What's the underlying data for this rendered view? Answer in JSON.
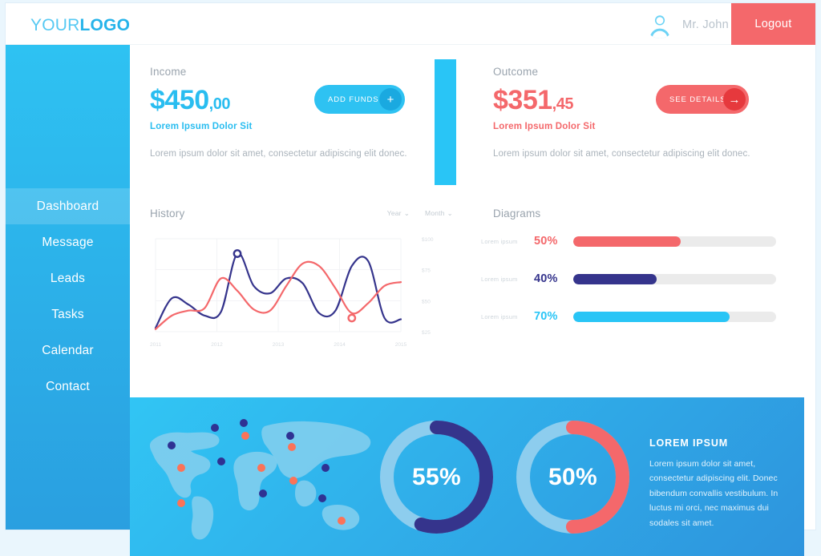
{
  "header": {
    "logo_part1": "YOUR",
    "logo_part2": "LOGO",
    "username": "Mr. John",
    "logout_label": "Logout",
    "avatar_icon": "user-avatar-icon"
  },
  "sidebar": {
    "items": [
      {
        "label": "Dashboard",
        "active": true
      },
      {
        "label": "Message",
        "active": false
      },
      {
        "label": "Leads",
        "active": false
      },
      {
        "label": "Tasks",
        "active": false
      },
      {
        "label": "Calendar",
        "active": false
      },
      {
        "label": "Contact",
        "active": false
      }
    ]
  },
  "cards": {
    "income": {
      "label": "Income",
      "amount_main": "$450",
      "amount_cents": ",00",
      "subtitle": "Lorem Ipsum Dolor Sit",
      "body": "Lorem ipsum dolor sit amet, consectetur adipiscing elit donec.",
      "button_label": "ADD FUNDS",
      "button_icon": "plus-icon",
      "accent_color": "#29c5f6"
    },
    "outcome": {
      "label": "Outcome",
      "amount_main": "$351",
      "amount_cents": ",45",
      "subtitle": "Lorem Ipsum Dolor Sit",
      "body": "Lorem ipsum dolor sit amet, consectetur adipiscing elit donec.",
      "button_label": "SEE DETAILS",
      "button_icon": "arrow-right-icon",
      "accent_color": "#f4686b"
    }
  },
  "history": {
    "title": "History",
    "select_year": "Year",
    "select_month": "Month",
    "chevron": "⌄"
  },
  "diagrams": {
    "title": "Diagrams",
    "bars": [
      {
        "label": "Lorem ipsum",
        "percent": "50%",
        "value": 53,
        "color": "#f4686b"
      },
      {
        "label": "Lorem ipsum",
        "percent": "40%",
        "value": 41,
        "color": "#35348c"
      },
      {
        "label": "Lorem ipsum",
        "percent": "70%",
        "value": 77,
        "color": "#29c5f6"
      }
    ]
  },
  "panel": {
    "heading": "LOREM IPSUM",
    "body": "Lorem ipsum dolor sit amet, consectetur adipiscing elit. Donec bibendum convallis vestibulum. In luctus mi orci, nec maximus dui sodales sit amet.",
    "donuts": [
      {
        "label": "55%",
        "value": 55,
        "color": "#35348c",
        "track": "#8dcdee"
      },
      {
        "label": "50%",
        "value": 50,
        "color": "#f4686b",
        "track": "#8dcdee"
      }
    ],
    "map_markers_navy": 8,
    "map_markers_coral": 7
  },
  "chart_data": [
    {
      "type": "line",
      "title": "History",
      "xlabel": "",
      "ylabel": "",
      "x": [
        "2011",
        "2012",
        "2013",
        "2014",
        "2015"
      ],
      "ytick_labels": [
        "$100",
        "$75",
        "$50",
        "$25"
      ],
      "ylim": [
        25,
        100
      ],
      "grid": true,
      "legend": "none",
      "series": [
        {
          "name": "navy",
          "color": "#35348c",
          "values": [
            28,
            52,
            47,
            38,
            41,
            88,
            62,
            56,
            68,
            64,
            40,
            42,
            78,
            82,
            36,
            35
          ],
          "marker": {
            "x_index": 5,
            "value": 88
          }
        },
        {
          "name": "coral",
          "color": "#f4686b",
          "values": [
            27,
            38,
            42,
            44,
            68,
            58,
            43,
            42,
            62,
            80,
            78,
            60,
            40,
            48,
            62,
            65
          ],
          "marker": {
            "x_index": 12,
            "value": 36
          }
        }
      ]
    },
    {
      "type": "bar",
      "title": "Diagrams",
      "orientation": "horizontal",
      "categories": [
        "Lorem ipsum",
        "Lorem ipsum",
        "Lorem ipsum"
      ],
      "values": [
        50,
        40,
        70
      ],
      "display_values": [
        "50%",
        "40%",
        "70%"
      ],
      "colors": [
        "#f4686b",
        "#35348c",
        "#29c5f6"
      ],
      "xlim": [
        0,
        100
      ]
    },
    {
      "type": "pie",
      "subtype": "donut",
      "title": "",
      "labels": [
        "55%",
        "50%"
      ],
      "values": [
        55,
        50
      ],
      "colors": [
        "#35348c",
        "#f4686b"
      ],
      "track_color": "#8dcdee"
    }
  ]
}
